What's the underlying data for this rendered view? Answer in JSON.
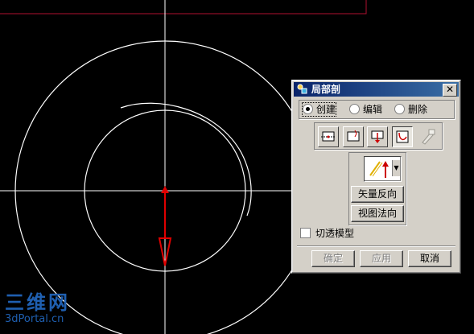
{
  "dialog": {
    "title": "局部剖",
    "close_label": "✕",
    "modes": [
      {
        "label": "创建",
        "selected": true
      },
      {
        "label": "编辑",
        "selected": false
      },
      {
        "label": "删除",
        "selected": false
      }
    ],
    "section_tools": [
      {
        "icon": "section-box-icon",
        "pressed": false
      },
      {
        "icon": "section-break-icon",
        "pressed": false
      },
      {
        "icon": "section-arrow-icon",
        "pressed": false
      },
      {
        "icon": "section-curve-icon",
        "pressed": true
      },
      {
        "icon": "section-pen-icon",
        "pressed": false,
        "disabled": true
      }
    ],
    "direction_dropdown_icon": "vector-direction-icon",
    "vector_reverse_label": "矢量反向",
    "view_normal_label": "视图法向",
    "cut_through_model_label": "切透模型",
    "ok_label": "确定",
    "apply_label": "应用",
    "cancel_label": "取消"
  },
  "watermark": {
    "line1": "三维网",
    "line2": "3dPortal.cn"
  },
  "colors": {
    "background": "#000000",
    "geometry": "#ffffff",
    "vector_arrow": "#e00000",
    "border_line": "#b01030",
    "watermark": "#1f5fb0",
    "titlebar": "#0a246a",
    "dialog_face": "#d4d0c8"
  }
}
